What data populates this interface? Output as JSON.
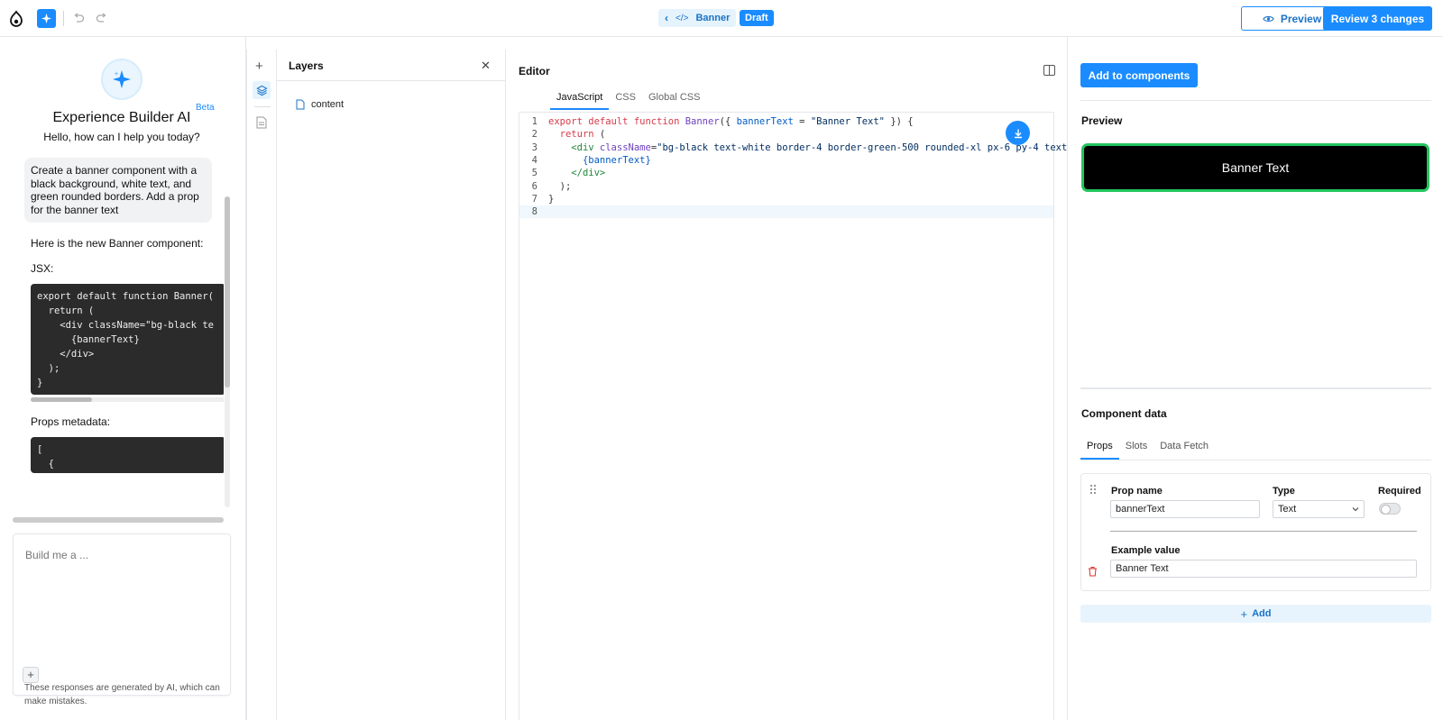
{
  "topbar": {
    "breadcrumb_label": "Banner",
    "draft_badge": "Draft",
    "preview_label": "Preview",
    "review_label": "Review 3 changes"
  },
  "ai": {
    "title": "Experience Builder AI",
    "beta": "Beta",
    "subtitle": "Hello, how can I help you today?",
    "user_message": "Create a banner component with a black background, white text, and green rounded borders. Add a prop for the banner text",
    "response_intro": "Here is the new Banner component:",
    "jsx_label": "JSX:",
    "jsx_code": "export default function Banner(\n  return (\n    <div className=\"bg-black te\n      {bannerText}\n    </div>\n  );\n}",
    "props_label": "Props metadata:",
    "props_code": "[\n  {",
    "input_placeholder": "Build me a ...",
    "disclaimer": "These responses are generated by AI, which can make mistakes."
  },
  "layers": {
    "title": "Layers",
    "items": [
      {
        "label": "content"
      }
    ]
  },
  "editor": {
    "title": "Editor",
    "tabs": [
      "JavaScript",
      "CSS",
      "Global CSS"
    ],
    "active_tab": "JavaScript",
    "line_numbers": [
      "1",
      "2",
      "3",
      "4",
      "5",
      "6",
      "7",
      "8"
    ],
    "code": {
      "l1_kw1": "export default function ",
      "l1_fn": "Banner",
      "l1_rest1": "({ ",
      "l1_param": "bannerText",
      "l1_rest2": " = ",
      "l1_str": "\"Banner Text\"",
      "l1_rest3": " }) {",
      "l2_kw": "return",
      "l2_rest": " (",
      "l3_tag": "<div ",
      "l3_attr": "className",
      "l3_eq": "=",
      "l3_str": "\"bg-black text-white border-4 border-green-500 rounded-xl px-6 py-4 text",
      "l4_var": "{bannerText}",
      "l5_tag": "</div>",
      "l6": ");",
      "l7": "}"
    }
  },
  "right": {
    "add_components_label": "Add to components",
    "preview_title": "Preview",
    "banner_text": "Banner Text",
    "component_data_title": "Component data",
    "tabs": [
      "Props",
      "Slots",
      "Data Fetch"
    ],
    "active_tab": "Props",
    "prop": {
      "name_label": "Prop name",
      "name_value": "bannerText",
      "type_label": "Type",
      "type_value": "Text",
      "required_label": "Required",
      "required": false,
      "example_label": "Example value",
      "example_value": "Banner Text"
    },
    "add_label": "Add"
  },
  "colors": {
    "accent": "#1a8cff",
    "banner_bg": "#000000",
    "banner_border": "#22c55e"
  }
}
